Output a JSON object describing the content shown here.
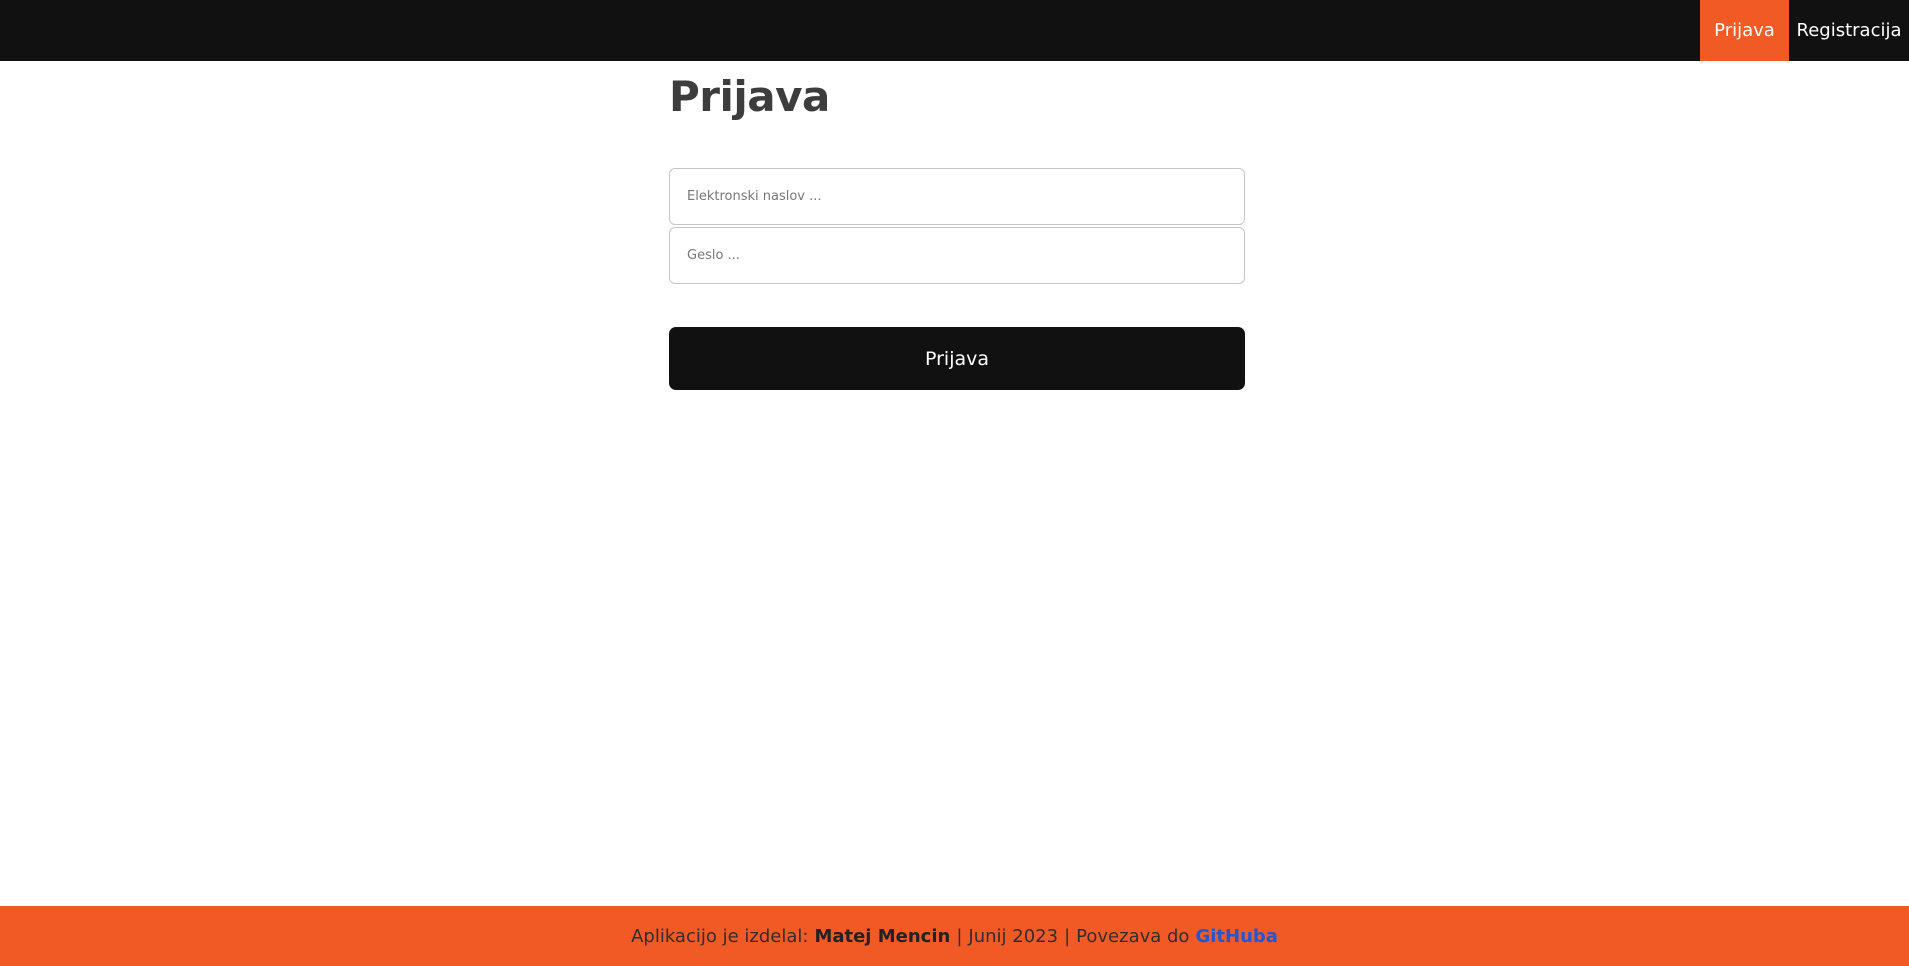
{
  "header": {
    "nav": {
      "login_label": "Prijava",
      "register_label": "Registracija"
    }
  },
  "main": {
    "title": "Prijava",
    "email": {
      "placeholder": "Elektronski naslov ...",
      "value": ""
    },
    "password": {
      "placeholder": "Geslo ...",
      "value": ""
    },
    "submit_label": "Prijava"
  },
  "footer": {
    "prefix": "Aplikacijo je izdelal:",
    "author": "Matej Mencin",
    "separator1": "|",
    "date": "Junij 2023",
    "separator2": "|",
    "link_prefix": "Povezava do",
    "link_label": "GitHuba"
  },
  "colors": {
    "accent": "#f15a24",
    "dark": "#111111",
    "link": "#1f57d6"
  }
}
